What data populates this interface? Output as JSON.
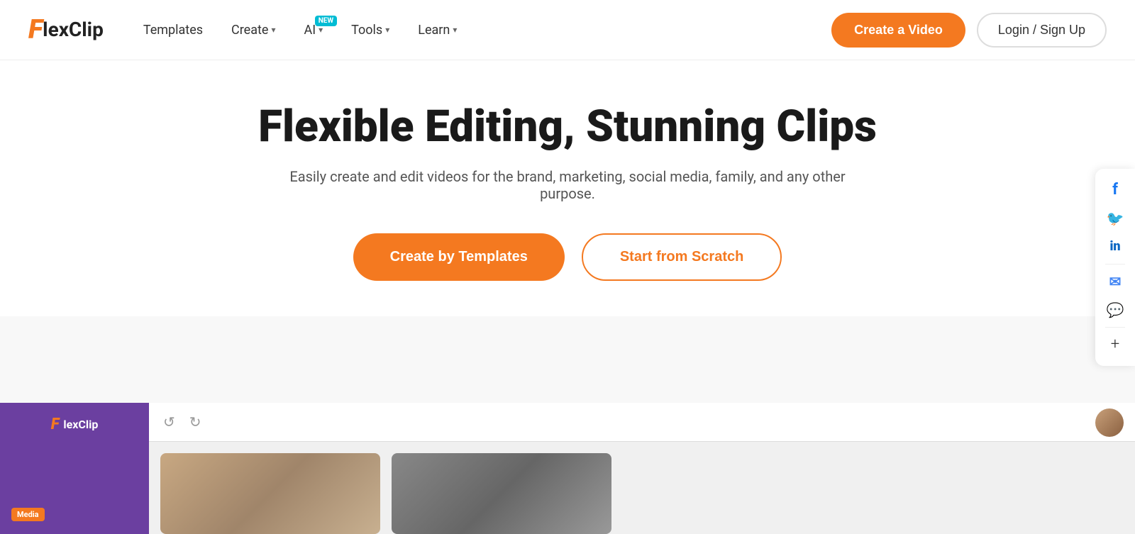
{
  "logo": {
    "f": "F",
    "rest": "lexClip"
  },
  "nav": {
    "templates": "Templates",
    "create": "Create",
    "ai": "AI",
    "ai_badge": "NEW",
    "tools": "Tools",
    "learn": "Learn"
  },
  "actions": {
    "create_video": "Create a Video",
    "login": "Login / Sign Up"
  },
  "hero": {
    "title": "Flexible Editing, Stunning Clips",
    "subtitle": "Easily create and edit videos for the brand, marketing, social media, family, and any other purpose.",
    "btn_templates": "Create by Templates",
    "btn_scratch": "Start from Scratch"
  },
  "editor": {
    "logo_f": "F",
    "logo_text": "lexClip",
    "media_label": "Media",
    "undo": "↺",
    "redo": "↻"
  },
  "social": {
    "facebook": "f",
    "twitter": "𝕏",
    "linkedin": "in",
    "email": "✉",
    "chat": "💬",
    "plus": "+"
  }
}
